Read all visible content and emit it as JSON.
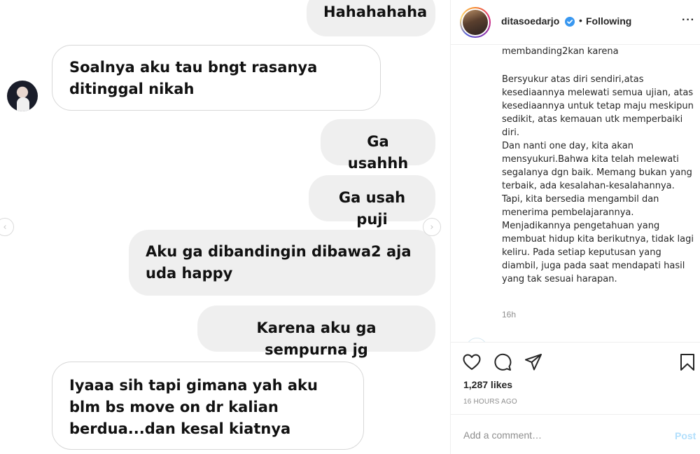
{
  "chat": {
    "messages": [
      {
        "side": "sent",
        "text": "Hahahahaha"
      },
      {
        "side": "received",
        "text": "Soalnya aku tau bngt rasanya ditinggal nikah"
      },
      {
        "side": "sent",
        "text": "Ga usahhh"
      },
      {
        "side": "sent",
        "text": "Ga usah puji"
      },
      {
        "side": "sent",
        "text": "Aku ga dibandingin dibawa2 aja uda happy"
      },
      {
        "side": "sent",
        "text": "Karena aku ga sempurna jg"
      },
      {
        "side": "received",
        "text": "Iyaaa sih tapi gimana yah aku blm bs move on dr kalian berdua...dan kesal kiatnya"
      }
    ],
    "prev_arrow": "‹",
    "next_arrow": "›"
  },
  "post": {
    "username": "ditasoedarjo",
    "separator": "•",
    "follow_status": "Following",
    "more_label": "···",
    "caption_cut": "membanding2kan karena",
    "caption_paragraphs": [
      "Bersyukur atas diri sendiri,atas kesediaannya melewati semua ujian, atas kesediaannya untuk tetap maju meskipun sedikit, atas kemauan utk memperbaiki diri.",
      "Dan nanti one day, kita akan mensyukuri.Bahwa kita telah melewati segalanya dgn baik. Memang bukan yang terbaik, ada kesalahan-kesalahannya. Tapi, kita bersedia mengambil dan menerima pembelajarannya. Menjadikannya pengetahuan yang membuat hidup kita berikutnya, tidak lagi keliru. Pada setiap keputusan yang diambil, juga pada saat mendapati hasil yang tak sesuai harapan."
    ],
    "caption_time": "16h",
    "likes": "1,287 likes",
    "time_ago": "16 HOURS AGO",
    "comment_placeholder": "Add a comment…",
    "post_label": "Post"
  },
  "icons": {
    "like": "heart-icon",
    "comment": "comment-icon",
    "share": "paper-plane-icon",
    "save": "bookmark-icon",
    "verified": "verified-badge-icon"
  },
  "colors": {
    "verified": "#3897f0",
    "post_button_disabled": "#b2dffc",
    "sent_bubble": "#efefef",
    "received_border": "#d7d7d7"
  }
}
